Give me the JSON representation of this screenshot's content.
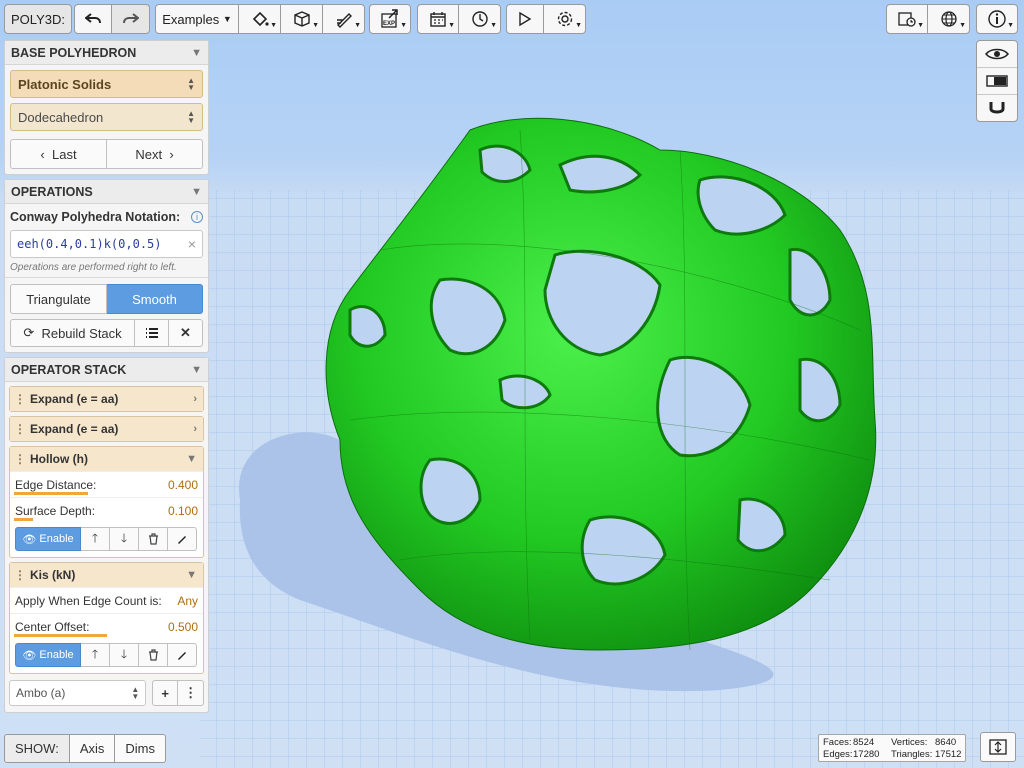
{
  "app": {
    "title": "POLY3D:"
  },
  "toolbar": {
    "examples_label": "Examples",
    "icons": [
      "undo-icon",
      "redo-icon",
      "paint-bucket-icon",
      "cube-icon",
      "pencil-ruler-icon",
      "export-icon",
      "calendar-icon",
      "clock-icon",
      "play-icon",
      "gear-icon",
      "calendar-clock-icon",
      "globe-icon",
      "info-icon"
    ],
    "export_badge": "EXP"
  },
  "right_tools": {
    "icons": [
      "eye-icon",
      "toggle-view-icon",
      "magnet-icon"
    ]
  },
  "base": {
    "header": "BASE POLYHEDRON",
    "family": "Platonic Solids",
    "solid": "Dodecahedron",
    "last_label": "Last",
    "next_label": "Next"
  },
  "operations": {
    "header": "OPERATIONS",
    "notation_label": "Conway Polyhedra Notation:",
    "notation_value": "eeh(0.4,0.1)k(0,0.5)",
    "hint": "Operations are performed right to left.",
    "triangulate_label": "Triangulate",
    "smooth_label": "Smooth",
    "rebuild_label": "Rebuild Stack"
  },
  "stack": {
    "header": "OPERATOR STACK",
    "expand1": "Expand (e = aa)",
    "expand2": "Expand (e = aa)",
    "hollow": {
      "title": "Hollow (h)",
      "edge_label": "Edge Distance:",
      "edge_value": "0.400",
      "edge_level": 0.4,
      "depth_label": "Surface Depth:",
      "depth_value": "0.100",
      "depth_level": 0.1,
      "enable_label": "Enable"
    },
    "kis": {
      "title": "Kis (kN)",
      "apply_label": "Apply When Edge Count is:",
      "apply_value": "Any",
      "offset_label": "Center Offset:",
      "offset_value": "0.500",
      "offset_level": 0.5,
      "enable_label": "Enable"
    },
    "add_select": "Ambo (a)"
  },
  "show": {
    "label": "SHOW:",
    "axis": "Axis",
    "dims": "Dims"
  },
  "stats": {
    "faces_label": "Faces:",
    "faces": "8524",
    "vertices_label": "Vertices:",
    "vertices": "8640",
    "edges_label": "Edges:",
    "edges": "17280",
    "triangles_label": "Triangles:",
    "triangles": "17512"
  },
  "colors": {
    "model": "#2fd92f",
    "accent": "#5d9ce0",
    "operator_header": "#f6e6cc",
    "slider": "#f0a73a"
  }
}
